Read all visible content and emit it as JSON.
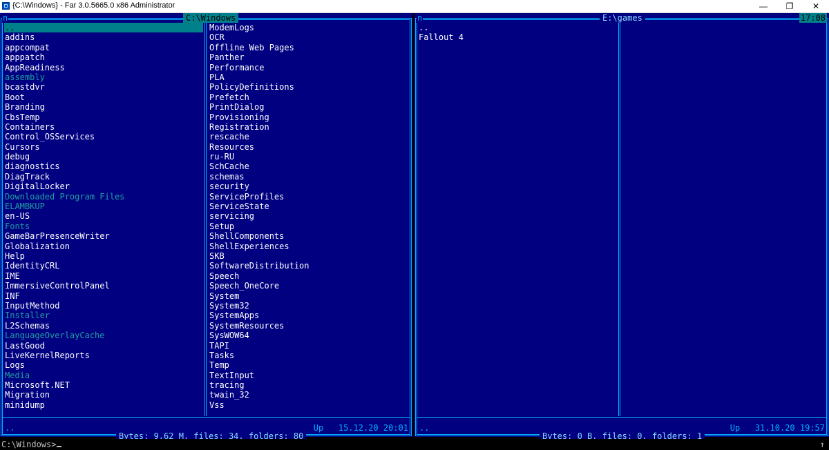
{
  "window": {
    "title": "{C:\\Windows} - Far 3.0.5665.0 x86 Administrator",
    "minimize": "—",
    "maximize": "❐",
    "close": "✕"
  },
  "left_panel": {
    "letter": "n",
    "path": "C:\\Windows",
    "columns": [
      [
        {
          "name": "..",
          "selected": true
        },
        {
          "name": "addins"
        },
        {
          "name": "appcompat"
        },
        {
          "name": "apppatch"
        },
        {
          "name": "AppReadiness"
        },
        {
          "name": "assembly",
          "dim": true
        },
        {
          "name": "bcastdvr"
        },
        {
          "name": "Boot"
        },
        {
          "name": "Branding"
        },
        {
          "name": "CbsTemp"
        },
        {
          "name": "Containers"
        },
        {
          "name": "Control_OSServices"
        },
        {
          "name": "Cursors"
        },
        {
          "name": "debug"
        },
        {
          "name": "diagnostics"
        },
        {
          "name": "DiagTrack"
        },
        {
          "name": "DigitalLocker"
        },
        {
          "name": "Downloaded Program Files",
          "dim": true
        },
        {
          "name": "ELAMBKUP",
          "dim": true
        },
        {
          "name": "en-US"
        },
        {
          "name": "Fonts",
          "dim": true
        },
        {
          "name": "GameBarPresenceWriter"
        },
        {
          "name": "Globalization"
        },
        {
          "name": "Help"
        },
        {
          "name": "IdentityCRL"
        },
        {
          "name": "IME"
        },
        {
          "name": "ImmersiveControlPanel"
        },
        {
          "name": "INF"
        },
        {
          "name": "InputMethod"
        },
        {
          "name": "Installer",
          "dim": true
        },
        {
          "name": "L2Schemas"
        },
        {
          "name": "LanguageOverlayCache",
          "dim": true
        },
        {
          "name": "LastGood"
        },
        {
          "name": "LiveKernelReports"
        },
        {
          "name": "Logs"
        },
        {
          "name": "Media",
          "dim": true
        },
        {
          "name": "Microsoft.NET"
        },
        {
          "name": "Migration"
        },
        {
          "name": "minidump"
        }
      ],
      [
        {
          "name": "ModemLogs"
        },
        {
          "name": "OCR"
        },
        {
          "name": "Offline Web Pages"
        },
        {
          "name": "Panther"
        },
        {
          "name": "Performance"
        },
        {
          "name": "PLA"
        },
        {
          "name": "PolicyDefinitions"
        },
        {
          "name": "Prefetch"
        },
        {
          "name": "PrintDialog"
        },
        {
          "name": "Provisioning"
        },
        {
          "name": "Registration"
        },
        {
          "name": "rescache"
        },
        {
          "name": "Resources"
        },
        {
          "name": "ru-RU"
        },
        {
          "name": "SchCache"
        },
        {
          "name": "schemas"
        },
        {
          "name": "security"
        },
        {
          "name": "ServiceProfiles"
        },
        {
          "name": "ServiceState"
        },
        {
          "name": "servicing"
        },
        {
          "name": "Setup"
        },
        {
          "name": "ShellComponents"
        },
        {
          "name": "ShellExperiences"
        },
        {
          "name": "SKB"
        },
        {
          "name": "SoftwareDistribution"
        },
        {
          "name": "Speech"
        },
        {
          "name": "Speech_OneCore"
        },
        {
          "name": "System"
        },
        {
          "name": "System32"
        },
        {
          "name": "SystemApps"
        },
        {
          "name": "SystemResources"
        },
        {
          "name": "SysWOW64"
        },
        {
          "name": "TAPI"
        },
        {
          "name": "Tasks"
        },
        {
          "name": "Temp"
        },
        {
          "name": "TextInput"
        },
        {
          "name": "tracing"
        },
        {
          "name": "twain_32"
        },
        {
          "name": "Vss"
        }
      ]
    ],
    "status_name": "..",
    "status_info": "Up   15.12.20 20:01",
    "summary": "Bytes: 9,62 M, files: 34, folders: 80"
  },
  "right_panel": {
    "letter": "n",
    "path": "E:\\games",
    "clock": "17:08",
    "columns": [
      [
        {
          "name": ".."
        },
        {
          "name": "Fallout 4"
        }
      ],
      []
    ],
    "status_name": "..",
    "status_info": "Up   31.10.20 19:57",
    "summary": "Bytes: 0 B, files: 0, folders: 1"
  },
  "command_line": {
    "prompt": "C:\\Windows>",
    "up_arrow": "↑"
  },
  "colors": {
    "panel_bg": "#000080",
    "frame": "#00b0ff",
    "cursor_bg": "#00808a",
    "file_text": "#ffffff",
    "hidden_text": "#20a0a0"
  }
}
